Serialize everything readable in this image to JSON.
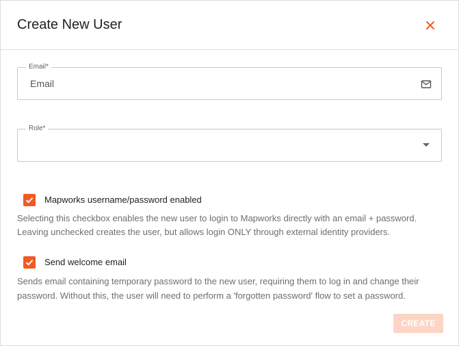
{
  "dialog": {
    "title": "Create New User",
    "close_icon": "close-icon",
    "accent_color": "#f15a24"
  },
  "email_field": {
    "label": "Email*",
    "placeholder": "Email",
    "value": "",
    "icon": "mail-icon"
  },
  "role_field": {
    "label": "Role*",
    "selected_value": "",
    "icon": "chevron-down-icon"
  },
  "mapworks_checkbox": {
    "checked": true,
    "label": "Mapworks username/password enabled",
    "help_line_1": "Selecting this checkbox enables the new user to login to Mapworks directly with an email + password.",
    "help_line_2": "Leaving unchecked creates the user, but allows login ONLY through external identity providers."
  },
  "welcome_checkbox": {
    "checked": true,
    "label": "Send welcome email",
    "help_line_1": "Sends email containing temporary password to the new user, requiring them to log in and change their",
    "help_line_2": "password. Without this, the user will need to perform a 'forgotten password' flow to set a password."
  },
  "actions": {
    "create_label": "CREATE",
    "create_disabled": true
  }
}
